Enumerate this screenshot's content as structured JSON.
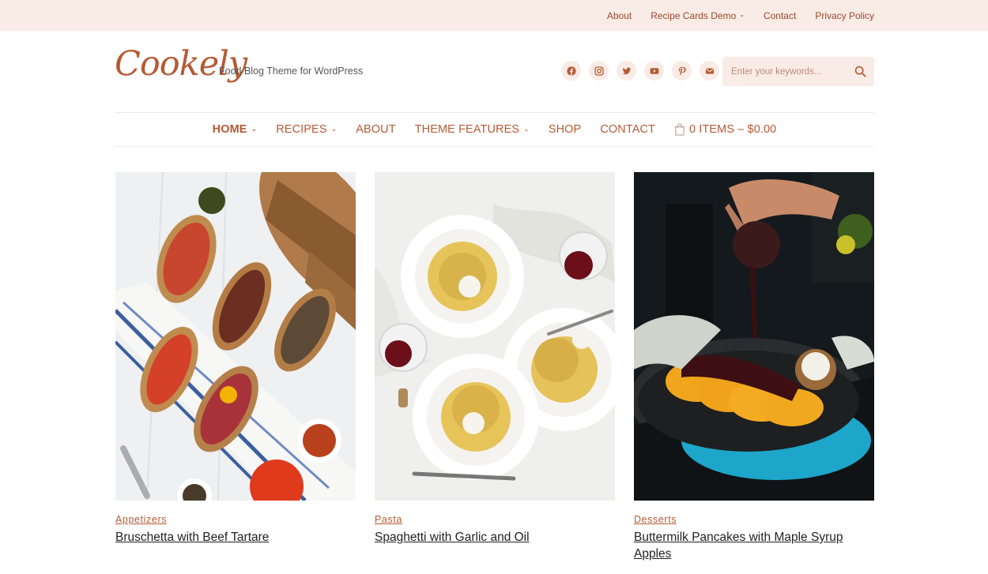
{
  "top_nav": {
    "items": [
      {
        "label": "About"
      },
      {
        "label": "Recipe Cards Demo",
        "has_dropdown": true
      },
      {
        "label": "Contact"
      },
      {
        "label": "Privacy Policy"
      }
    ]
  },
  "header": {
    "logo": "Cookely",
    "tagline": "Food Blog Theme for WordPress",
    "socials": [
      "facebook-icon",
      "instagram-icon",
      "twitter-icon",
      "youtube-icon",
      "pinterest-icon",
      "email-icon"
    ],
    "search": {
      "placeholder": "Enter your keywords..."
    }
  },
  "main_nav": {
    "items": [
      {
        "label": "HOME",
        "has_dropdown": true,
        "active": true
      },
      {
        "label": "RECIPES",
        "has_dropdown": true
      },
      {
        "label": "ABOUT"
      },
      {
        "label": "THEME FEATURES",
        "has_dropdown": true
      },
      {
        "label": "SHOP"
      },
      {
        "label": "CONTACT"
      }
    ],
    "cart_label": "0 ITEMS – $0.00"
  },
  "posts": [
    {
      "category": "Appetizers",
      "title": "Bruschetta with Beef Tartare"
    },
    {
      "category": "Pasta",
      "title": "Spaghetti with Garlic and Oil"
    },
    {
      "category": "Desserts",
      "title": "Buttermilk Pancakes with Maple Syrup Apples"
    }
  ],
  "colors": {
    "accent": "#b65a34",
    "topbar_bg": "#f9ebe5",
    "text": "#222222"
  }
}
